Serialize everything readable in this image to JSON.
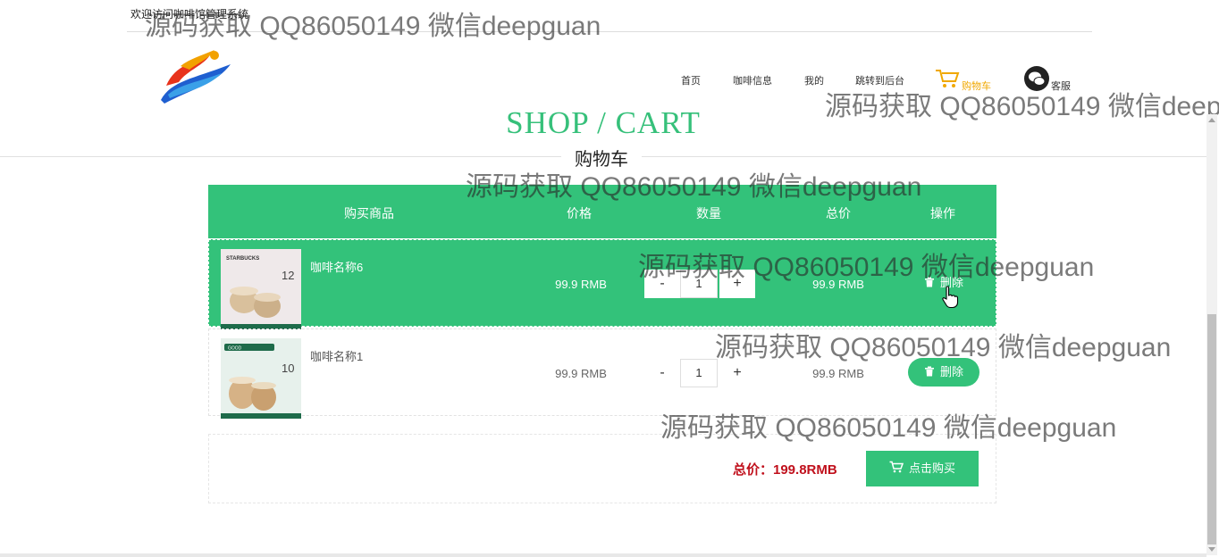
{
  "top": {
    "welcome": "欢迎访问咖啡馆管理系统"
  },
  "nav": {
    "home": "首页",
    "coffee_info": "咖啡信息",
    "mine": "我的",
    "admin": "跳转到后台",
    "cart": "购物车",
    "service": "客服"
  },
  "header": {
    "title": "SHOP / CART",
    "subtitle": "购物车"
  },
  "table": {
    "columns": [
      "购买商品",
      "价格",
      "数量",
      "总价",
      "操作"
    ],
    "rows": [
      {
        "name": "咖啡名称6",
        "price": "99.9 RMB",
        "qty": "1",
        "total": "99.9 RMB",
        "action": "删除",
        "img_price": "12",
        "img_brand": "STARBUCKS"
      },
      {
        "name": "咖啡名称1",
        "price": "99.9 RMB",
        "qty": "1",
        "total": "99.9 RMB",
        "action": "删除",
        "img_price": "10",
        "img_brand": "GOOD"
      }
    ]
  },
  "qty_controls": {
    "minus": "-",
    "plus": "+"
  },
  "footer": {
    "total": "总价：199.8RMB",
    "buy": "点击购买"
  },
  "watermark": "源码获取 QQ86050149 微信deepguan",
  "colors": {
    "accent": "#33c27a",
    "total_red": "#c0101c",
    "cart_nav": "#f0a800"
  }
}
